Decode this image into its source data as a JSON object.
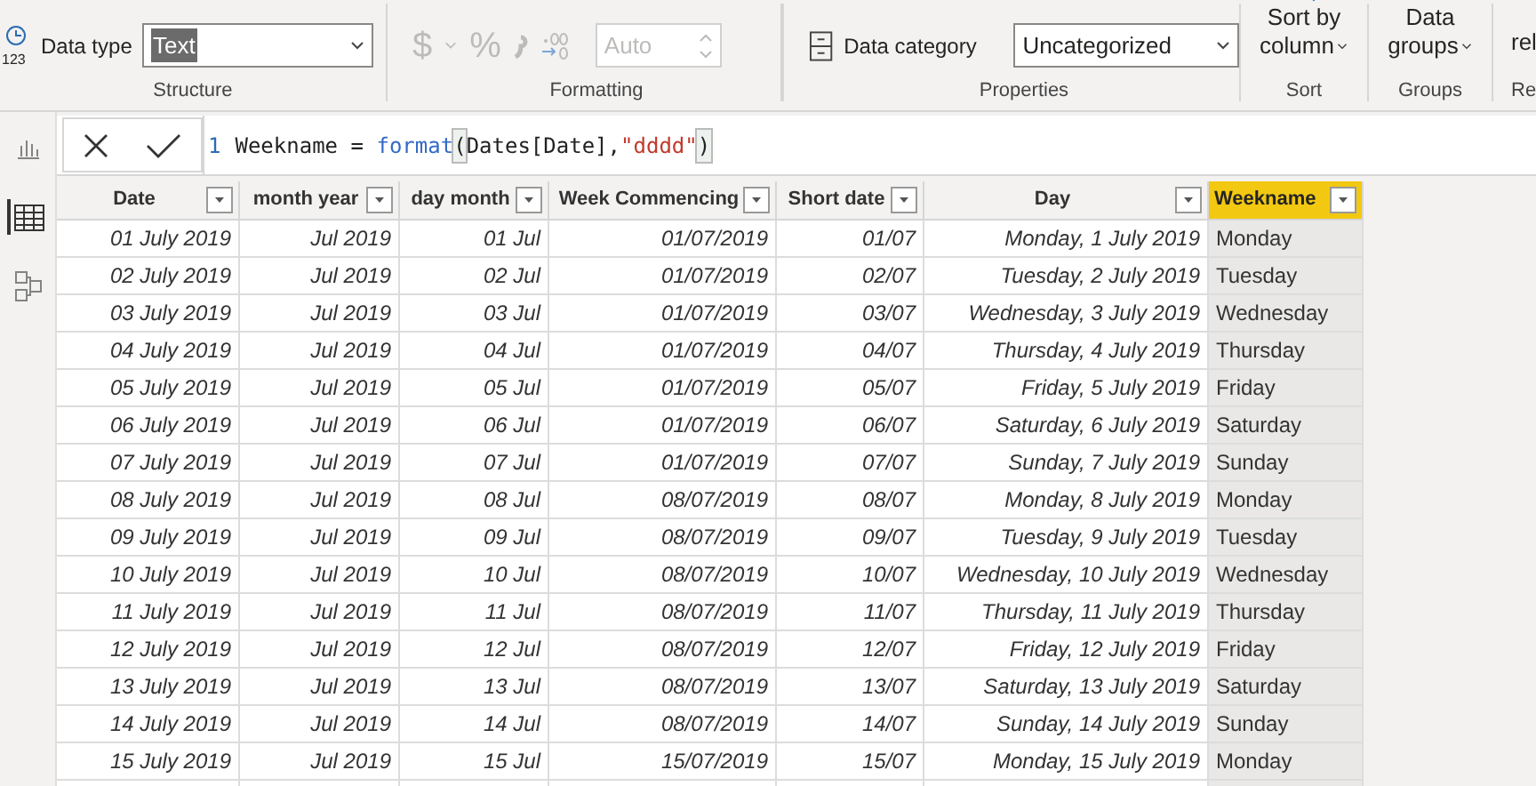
{
  "ribbon": {
    "structure": {
      "label": "Structure",
      "data_type_icon_text": "123",
      "data_type_label": "Data type",
      "data_type_value": "Text"
    },
    "formatting": {
      "label": "Formatting",
      "disabled": true,
      "currency_symbol": "$",
      "percent_symbol": "%",
      "decimal_value": "Auto"
    },
    "properties": {
      "label": "Properties",
      "category_label": "Data category",
      "category_value": "Uncategorized"
    },
    "sort": {
      "label": "Sort",
      "button_lines": [
        "Sort by",
        "column"
      ]
    },
    "groups": {
      "label": "Groups",
      "button_lines": [
        "Data",
        "groups"
      ]
    },
    "relationships": {
      "label": "Re",
      "button_text": "rel"
    }
  },
  "nav": [
    {
      "kind": "report",
      "selected": false
    },
    {
      "kind": "data",
      "selected": true
    },
    {
      "kind": "model",
      "selected": false
    }
  ],
  "formula": {
    "line_number": "1",
    "tokens": [
      {
        "kind": "plain",
        "text": "Weekname = "
      },
      {
        "kind": "function",
        "text": "format"
      },
      {
        "kind": "paren",
        "text": "("
      },
      {
        "kind": "plain",
        "text": "Dates[Date],"
      },
      {
        "kind": "string",
        "text": "\"dddd\""
      },
      {
        "kind": "paren",
        "text": ")"
      }
    ]
  },
  "table": {
    "columns": [
      {
        "name": "Date",
        "kind": "formatted",
        "selected": false
      },
      {
        "name": "month year",
        "kind": "formatted",
        "selected": false
      },
      {
        "name": "day month",
        "kind": "formatted",
        "selected": false
      },
      {
        "name": "Week Commencing",
        "kind": "formatted",
        "selected": false
      },
      {
        "name": "Short date",
        "kind": "formatted",
        "selected": false
      },
      {
        "name": "Day",
        "kind": "formatted",
        "selected": false
      },
      {
        "name": "Weekname",
        "kind": "text",
        "selected": true
      }
    ],
    "rows": [
      [
        "01 July 2019",
        "Jul 2019",
        "01 Jul",
        "01/07/2019",
        "01/07",
        "Monday, 1 July 2019",
        "Monday"
      ],
      [
        "02 July 2019",
        "Jul 2019",
        "02 Jul",
        "01/07/2019",
        "02/07",
        "Tuesday, 2 July 2019",
        "Tuesday"
      ],
      [
        "03 July 2019",
        "Jul 2019",
        "03 Jul",
        "01/07/2019",
        "03/07",
        "Wednesday, 3 July 2019",
        "Wednesday"
      ],
      [
        "04 July 2019",
        "Jul 2019",
        "04 Jul",
        "01/07/2019",
        "04/07",
        "Thursday, 4 July 2019",
        "Thursday"
      ],
      [
        "05 July 2019",
        "Jul 2019",
        "05 Jul",
        "01/07/2019",
        "05/07",
        "Friday, 5 July 2019",
        "Friday"
      ],
      [
        "06 July 2019",
        "Jul 2019",
        "06 Jul",
        "01/07/2019",
        "06/07",
        "Saturday, 6 July 2019",
        "Saturday"
      ],
      [
        "07 July 2019",
        "Jul 2019",
        "07 Jul",
        "01/07/2019",
        "07/07",
        "Sunday, 7 July 2019",
        "Sunday"
      ],
      [
        "08 July 2019",
        "Jul 2019",
        "08 Jul",
        "08/07/2019",
        "08/07",
        "Monday, 8 July 2019",
        "Monday"
      ],
      [
        "09 July 2019",
        "Jul 2019",
        "09 Jul",
        "08/07/2019",
        "09/07",
        "Tuesday, 9 July 2019",
        "Tuesday"
      ],
      [
        "10 July 2019",
        "Jul 2019",
        "10 Jul",
        "08/07/2019",
        "10/07",
        "Wednesday, 10 July 2019",
        "Wednesday"
      ],
      [
        "11 July 2019",
        "Jul 2019",
        "11 Jul",
        "08/07/2019",
        "11/07",
        "Thursday, 11 July 2019",
        "Thursday"
      ],
      [
        "12 July 2019",
        "Jul 2019",
        "12 Jul",
        "08/07/2019",
        "12/07",
        "Friday, 12 July 2019",
        "Friday"
      ],
      [
        "13 July 2019",
        "Jul 2019",
        "13 Jul",
        "08/07/2019",
        "13/07",
        "Saturday, 13 July 2019",
        "Saturday"
      ],
      [
        "14 July 2019",
        "Jul 2019",
        "14 Jul",
        "08/07/2019",
        "14/07",
        "Sunday, 14 July 2019",
        "Sunday"
      ],
      [
        "15 July 2019",
        "Jul 2019",
        "15 Jul",
        "15/07/2019",
        "15/07",
        "Monday, 15 July 2019",
        "Monday"
      ]
    ]
  }
}
